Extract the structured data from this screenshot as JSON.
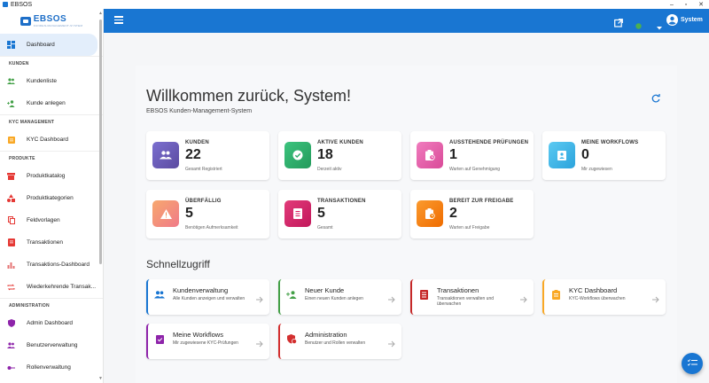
{
  "window": {
    "title": "EBSOS"
  },
  "logo": {
    "title": "EBSOS",
    "subtitle": "KUNDEN-MANAGEMENT-SYSTEM"
  },
  "sidebar": {
    "dashboard": "Dashboard",
    "sections": {
      "kunden": "KUNDEN",
      "kyc": "KYC MANAGEMENT",
      "produkte": "PRODUKTE",
      "administration": "ADMINISTRATION"
    },
    "items": {
      "kundenliste": "Kundenliste",
      "kunde_anlegen": "Kunde anlegen",
      "kyc_dashboard": "KYC Dashboard",
      "produktkatalog": "Produktkatalog",
      "produktkategorien": "Produktkategorien",
      "feldvorlagen": "Feldvorlagen",
      "transaktionen": "Transaktionen",
      "transaktions_dashboard": "Transaktions-Dashboard",
      "wiederkehrende": "Wiederkehrende Transak...",
      "admin_dashboard": "Admin Dashboard",
      "benutzerverwaltung": "Benutzerverwaltung",
      "rollenverwaltung": "Rollenverwaltung"
    }
  },
  "header": {
    "user_name": "System",
    "status_color": "#4caf50",
    "bar_color": "#1976d2"
  },
  "main": {
    "welcome": "Willkommen zurück, System!",
    "subtitle": "EBSOS Kunden-Management-System",
    "quick_title": "Schnellzugriff"
  },
  "stats": [
    {
      "label": "KUNDEN",
      "value": "22",
      "desc": "Gesamt Registriert",
      "color": "#6a5bb3"
    },
    {
      "label": "AKTIVE KUNDEN",
      "value": "18",
      "desc": "Derzeit aktiv",
      "color": "#2eaa68"
    },
    {
      "label": "AUSSTEHENDE PRÜFUNGEN",
      "value": "1",
      "desc": "Warten auf Genehmigung",
      "color": "#e85aa8"
    },
    {
      "label": "MEINE WORKFLOWS",
      "value": "0",
      "desc": "Mir zugewiesen",
      "color": "#3db3e8"
    },
    {
      "label": "ÜBERFÄLLIG",
      "value": "5",
      "desc": "Benötigen Aufmerksamkeit",
      "color": "#f0905a"
    },
    {
      "label": "TRANSAKTIONEN",
      "value": "5",
      "desc": "Gesamt",
      "color": "#d81b60"
    },
    {
      "label": "BEREIT ZUR FREIGABE",
      "value": "2",
      "desc": "Warten auf Freigabe",
      "color": "#f57c00"
    }
  ],
  "quick": [
    {
      "title": "Kundenverwaltung",
      "desc": "Alle Kunden anzeigen und verwalten",
      "color": "#1976d2"
    },
    {
      "title": "Neuer Kunde",
      "desc": "Einen neuen Kunden anlegen",
      "color": "#43a047"
    },
    {
      "title": "Transaktionen",
      "desc": "Transaktionen verwalten und überwachen",
      "color": "#c62828"
    },
    {
      "title": "KYC Dashboard",
      "desc": "KYC-Workflows überwachen",
      "color": "#f9a825"
    },
    {
      "title": "Meine Workflows",
      "desc": "Mir zugewiesene KYC-Prüfungen",
      "color": "#8e24aa"
    },
    {
      "title": "Administration",
      "desc": "Benutzer und Rollen verwalten",
      "color": "#d32f2f"
    }
  ]
}
